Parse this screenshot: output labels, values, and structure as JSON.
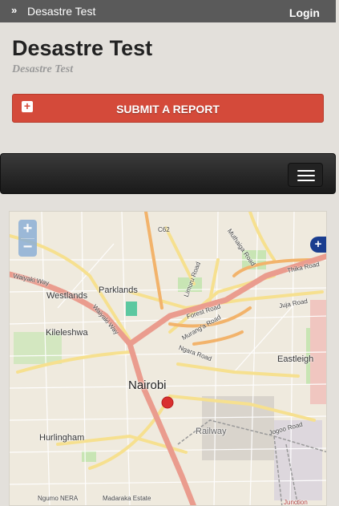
{
  "topbar": {
    "site_name": "Desastre Test",
    "login": "Login"
  },
  "brand": {
    "title": "Desastre Test",
    "subtitle": "Desastre Test"
  },
  "actions": {
    "submit_report": "SUBMIT A REPORT"
  },
  "map": {
    "zoom_in": "+",
    "zoom_out": "−",
    "layers_control": "+",
    "labels": {
      "c62": "C62",
      "westlands": "Westlands",
      "parklands": "Parklands",
      "kileleshwa": "Kileleshwa",
      "nairobi": "Nairobi",
      "eastleigh": "Eastleigh",
      "hurlingham": "Hurlingham",
      "ngumo": "Ngumo NERA",
      "madaraka": "Madaraka Estate",
      "waiyaki_way": "Waiyaki Way",
      "waiyaki_way2": "Waiyaki Way",
      "forest_road": "Forest Road",
      "muranga_road": "Murang'a Road",
      "juja_road": "Juja Road",
      "thika_road": "Thika Road",
      "ngara_road": "Ngara Road",
      "muthaiga_road": "Muthaiga Road",
      "limuru_road": "Limuru Road",
      "jogoo_road": "Jogoo Road",
      "railway": "Railway",
      "junction": "Junction"
    },
    "marker_color": "#d9302f"
  }
}
